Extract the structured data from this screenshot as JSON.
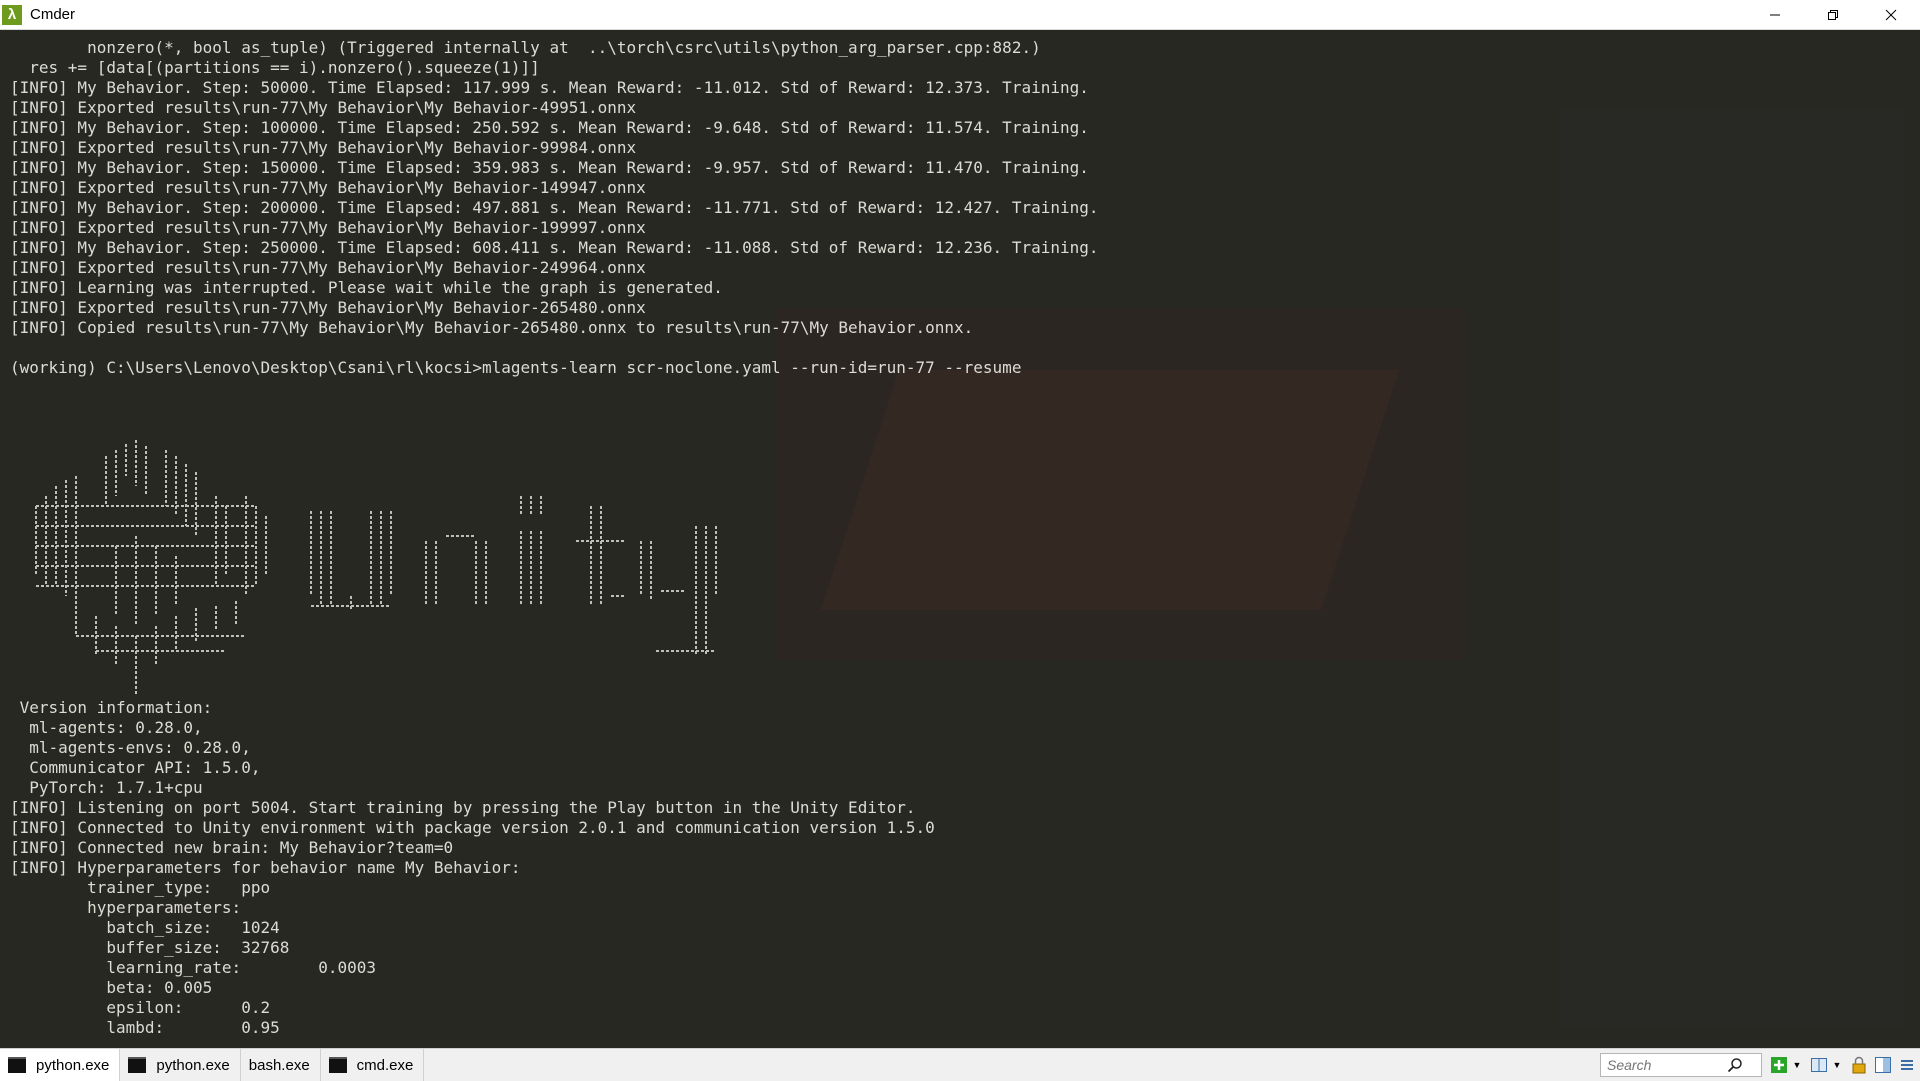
{
  "window": {
    "title": "Cmder",
    "icon": "lambda-icon"
  },
  "console": {
    "lines": [
      "        nonzero(*, bool as_tuple) (Triggered internally at  ..\\torch\\csrc\\utils\\python_arg_parser.cpp:882.)",
      "  res += [data[(partitions == i).nonzero().squeeze(1)]]",
      "[INFO] My Behavior. Step: 50000. Time Elapsed: 117.999 s. Mean Reward: -11.012. Std of Reward: 12.373. Training.",
      "[INFO] Exported results\\run-77\\My Behavior\\My Behavior-49951.onnx",
      "[INFO] My Behavior. Step: 100000. Time Elapsed: 250.592 s. Mean Reward: -9.648. Std of Reward: 11.574. Training.",
      "[INFO] Exported results\\run-77\\My Behavior\\My Behavior-99984.onnx",
      "[INFO] My Behavior. Step: 150000. Time Elapsed: 359.983 s. Mean Reward: -9.957. Std of Reward: 11.470. Training.",
      "[INFO] Exported results\\run-77\\My Behavior\\My Behavior-149947.onnx",
      "[INFO] My Behavior. Step: 200000. Time Elapsed: 497.881 s. Mean Reward: -11.771. Std of Reward: 12.427. Training.",
      "[INFO] Exported results\\run-77\\My Behavior\\My Behavior-199997.onnx",
      "[INFO] My Behavior. Step: 250000. Time Elapsed: 608.411 s. Mean Reward: -11.088. Std of Reward: 12.236. Training.",
      "[INFO] Exported results\\run-77\\My Behavior\\My Behavior-249964.onnx",
      "[INFO] Learning was interrupted. Please wait while the graph is generated.",
      "[INFO] Exported results\\run-77\\My Behavior\\My Behavior-265480.onnx",
      "[INFO] Copied results\\run-77\\My Behavior\\My Behavior-265480.onnx to results\\run-77\\My Behavior.onnx.",
      "",
      "(working) C:\\Users\\Lenovo\\Desktop\\Csani\\rl\\kocsi>mlagents-learn scr-noclone.yaml --run-id=run-77 --resume",
      "",
      "",
      "",
      "",
      "",
      "",
      "",
      "",
      "",
      "",
      "",
      "",
      "",
      "",
      "",
      "",
      " Version information:",
      "  ml-agents: 0.28.0,",
      "  ml-agents-envs: 0.28.0,",
      "  Communicator API: 1.5.0,",
      "  PyTorch: 1.7.1+cpu",
      "[INFO] Listening on port 5004. Start training by pressing the Play button in the Unity Editor.",
      "[INFO] Connected to Unity environment with package version 2.0.1 and communication version 1.5.0",
      "[INFO] Connected new brain: My Behavior?team=0",
      "[INFO] Hyperparameters for behavior name My Behavior:",
      "        trainer_type:   ppo",
      "        hyperparameters:",
      "          batch_size:   1024",
      "          buffer_size:  32768",
      "          learning_rate:        0.0003",
      "          beta: 0.005",
      "          epsilon:      0.2",
      "          lambd:        0.95"
    ],
    "ascii_logo": "Unity"
  },
  "tabs": [
    {
      "label": "python.exe",
      "icon": "console-icon",
      "active": true
    },
    {
      "label": "python.exe",
      "icon": "console-icon",
      "active": false
    },
    {
      "label": "bash.exe",
      "icon": "",
      "active": false
    },
    {
      "label": "cmd.exe",
      "icon": "console-icon",
      "active": false
    }
  ],
  "tray": {
    "search_placeholder": "Search"
  },
  "colors": {
    "console_bg": "#272822",
    "console_text": "#dcdcd2",
    "app_icon": "#6e9a1e",
    "add_button": "#2aa52a"
  }
}
